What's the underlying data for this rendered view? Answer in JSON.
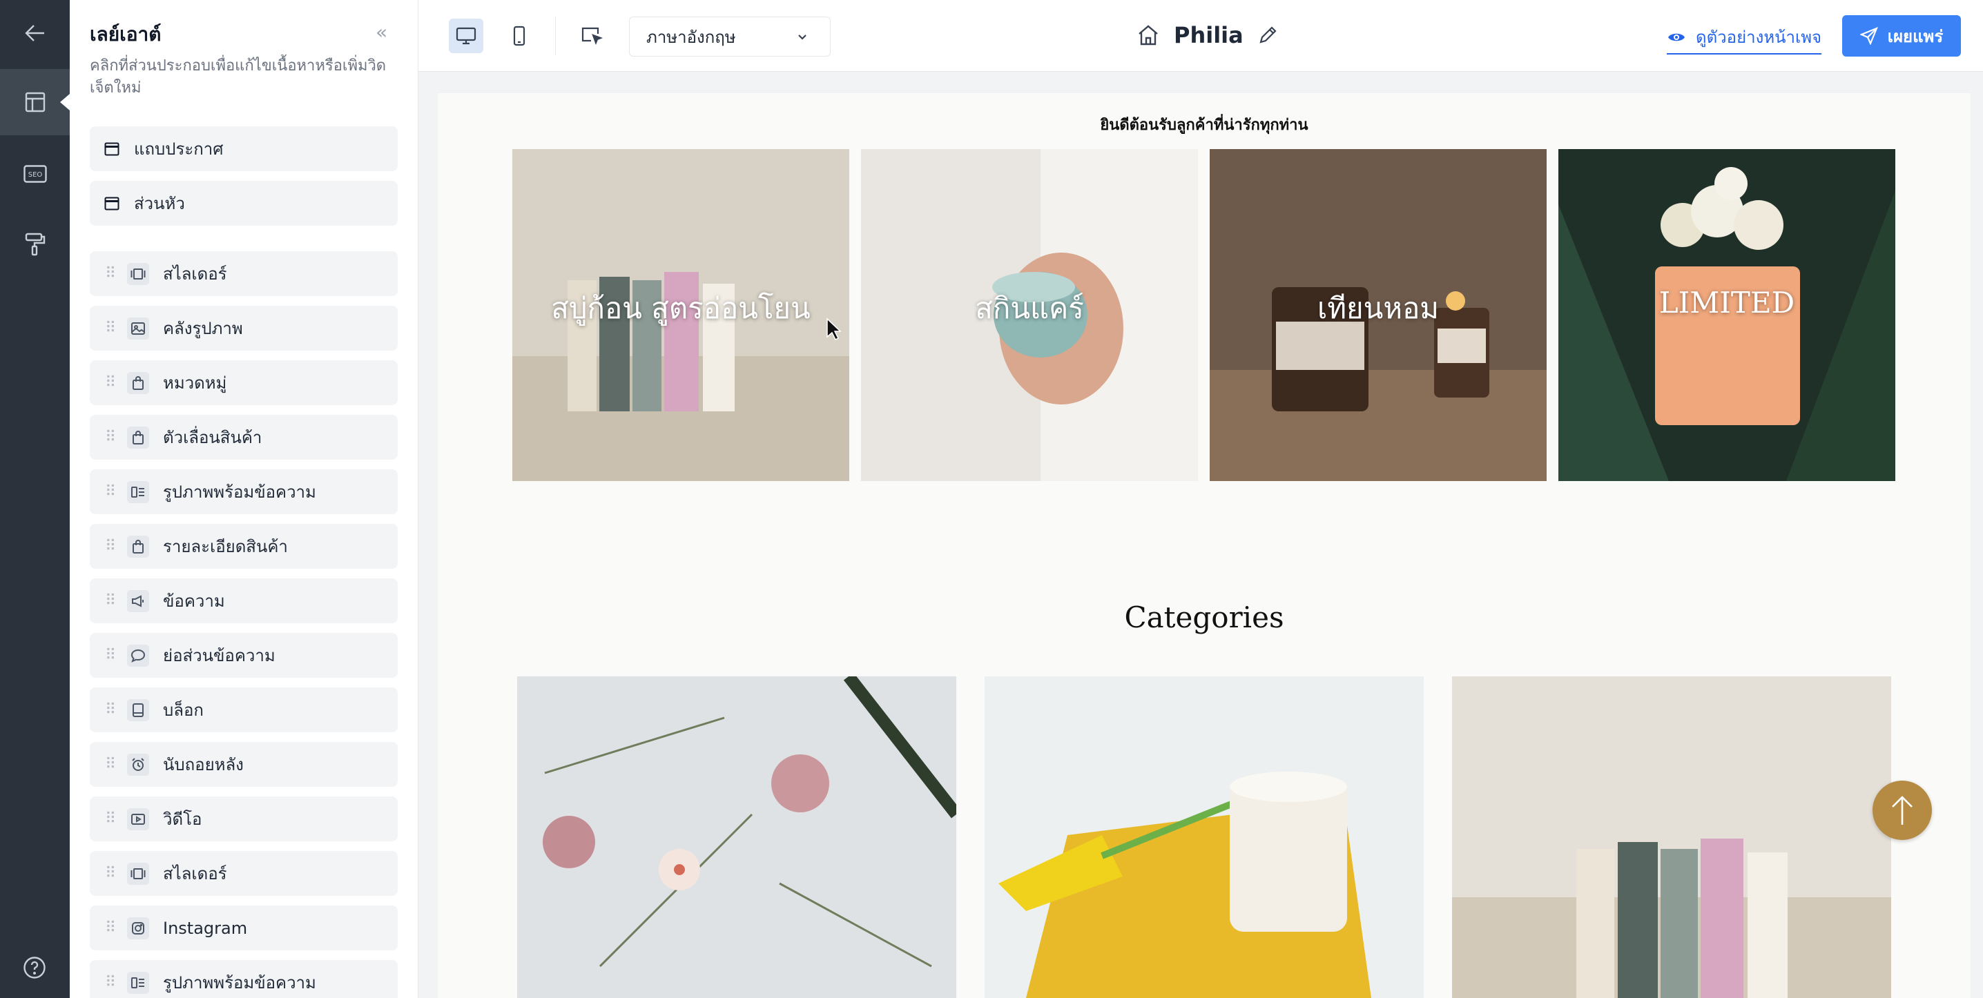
{
  "rail": {
    "items": [
      {
        "name": "back-arrow-icon"
      },
      {
        "name": "layout-icon",
        "active": true
      },
      {
        "name": "seo-icon",
        "label": "SEO"
      },
      {
        "name": "paint-roller-icon"
      }
    ],
    "help_icon": "help-circle-icon"
  },
  "panel": {
    "title": "เลย์เอาต์",
    "description": "คลิกที่ส่วนประกอบเพื่อแก้ไขเนื้อหาหรือเพิ่มวิดเจ็ตใหม่",
    "fixed_sections": [
      {
        "label": "แถบประกาศ",
        "icon": "window-icon"
      },
      {
        "label": "ส่วนหัว",
        "icon": "window-icon"
      }
    ],
    "widgets": [
      {
        "label": "สไลเดอร์",
        "icon": "slider-icon"
      },
      {
        "label": "คลังรูปภาพ",
        "icon": "image-icon"
      },
      {
        "label": "หมวดหมู่",
        "icon": "bag-icon"
      },
      {
        "label": "ตัวเลื่อนสินค้า",
        "icon": "bag-icon"
      },
      {
        "label": "รูปภาพพร้อมข้อความ",
        "icon": "image-text-icon"
      },
      {
        "label": "รายละเอียดสินค้า",
        "icon": "bag-icon"
      },
      {
        "label": "ข้อความ",
        "icon": "megaphone-icon"
      },
      {
        "label": "ย่อส่วนข้อความ",
        "icon": "chat-bubble-icon"
      },
      {
        "label": "บล็อก",
        "icon": "tablet-icon"
      },
      {
        "label": "นับถอยหลัง",
        "icon": "alarm-clock-icon"
      },
      {
        "label": "วิดีโอ",
        "icon": "video-icon"
      },
      {
        "label": "สไลเดอร์",
        "icon": "slider-icon"
      },
      {
        "label": "Instagram",
        "icon": "instagram-icon"
      },
      {
        "label": "รูปภาพพร้อมข้อความ",
        "icon": "image-text-icon"
      }
    ]
  },
  "toolbar": {
    "language": "ภาษาอังกฤษ",
    "site_name": "Philia",
    "preview_label": "ดูตัวอย่างหน้าเพจ",
    "publish_label": "เผยแพร่"
  },
  "canvas": {
    "announcement": "ยินดีต้อนรับลูกค้าที่น่ารักทุกท่าน",
    "tiles": [
      {
        "label": "สบู่ก้อน สูตรอ่อนโยน"
      },
      {
        "label": "สกินแคร์"
      },
      {
        "label": "เทียนหอม"
      },
      {
        "label": "LIMITED"
      }
    ],
    "categories_heading": "Categories"
  },
  "colors": {
    "rail": "#2b323b",
    "primary": "#3b82f6",
    "scroll_top": "#b58a43"
  }
}
